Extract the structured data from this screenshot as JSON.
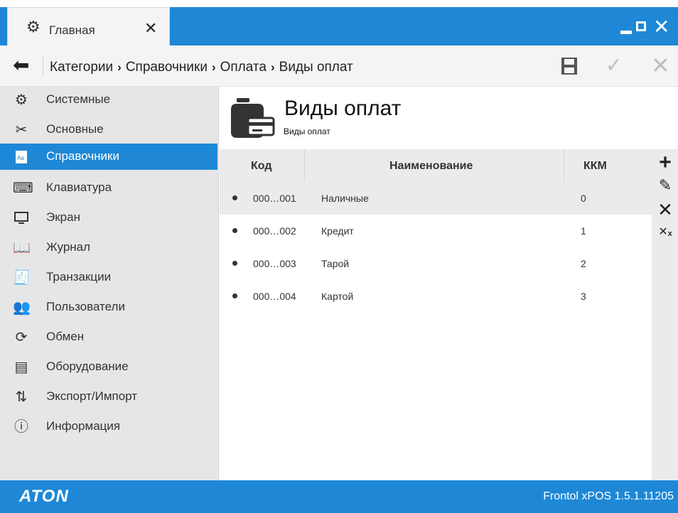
{
  "tab": {
    "label": "Главная"
  },
  "breadcrumb": {
    "items": [
      "Категории",
      "Справочники",
      "Оплата",
      "Виды оплат"
    ]
  },
  "sidebar": {
    "items": [
      {
        "label": "Системные",
        "icon": "gears-icon"
      },
      {
        "label": "Основные",
        "icon": "tools-icon"
      },
      {
        "label": "Справочники",
        "icon": "reference-book-icon",
        "active": true
      },
      {
        "label": "Клавиатура",
        "icon": "keyboard-icon"
      },
      {
        "label": "Экран",
        "icon": "monitor-icon"
      },
      {
        "label": "Журнал",
        "icon": "open-book-icon"
      },
      {
        "label": "Транзакции",
        "icon": "receipt-icon"
      },
      {
        "label": "Пользователи",
        "icon": "users-icon"
      },
      {
        "label": "Обмен",
        "icon": "sync-icon"
      },
      {
        "label": "Оборудование",
        "icon": "cash-register-icon"
      },
      {
        "label": "Экспорт/Импорт",
        "icon": "export-import-icon"
      },
      {
        "label": "Информация",
        "icon": "info-icon"
      }
    ]
  },
  "page": {
    "title": "Виды оплат",
    "subtitle": "Виды оплат"
  },
  "table": {
    "columns": [
      "Код",
      "Наименование",
      "ККМ"
    ],
    "rows": [
      {
        "code": "000…001",
        "name": "Наличные",
        "kkm": "0",
        "selected": true
      },
      {
        "code": "000…002",
        "name": "Кредит",
        "kkm": "1"
      },
      {
        "code": "000…003",
        "name": "Тарой",
        "kkm": "2"
      },
      {
        "code": "000…004",
        "name": "Картой",
        "kkm": "3"
      }
    ]
  },
  "statusbar": {
    "logo": "ATON",
    "version": "Frontol xPOS 1.5.1.11205"
  },
  "colors": {
    "accent": "#1e88d6",
    "sidebar": "#e6e6e6",
    "header": "#ebebeb"
  }
}
